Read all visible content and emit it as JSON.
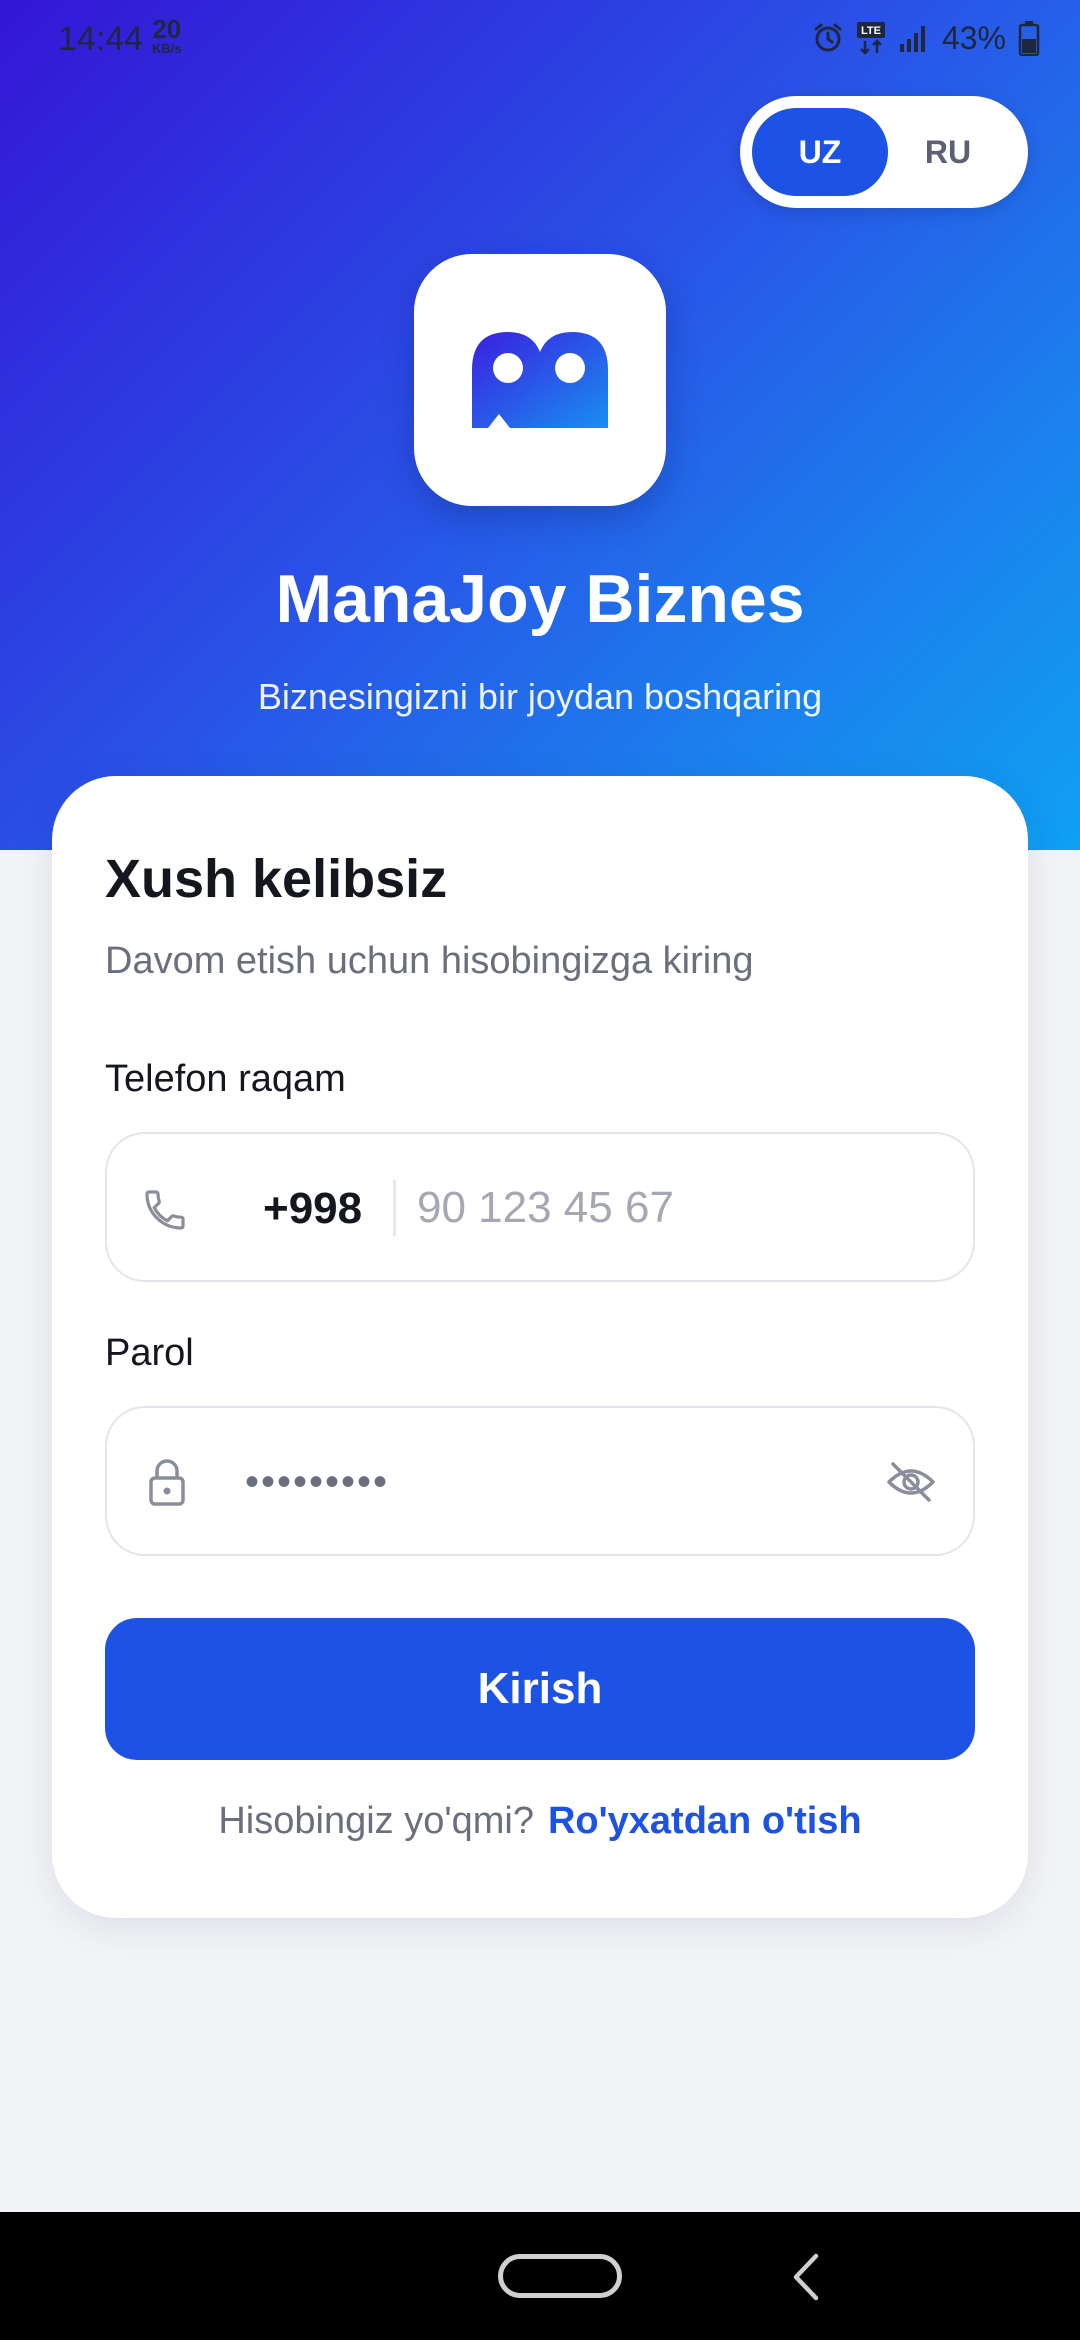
{
  "status_bar": {
    "time": "14:44",
    "net_speed_value": "20",
    "net_speed_unit": "KB/s",
    "network": "LTE",
    "battery": "43%"
  },
  "language_toggle": {
    "options": [
      "UZ",
      "RU"
    ],
    "selected": "UZ"
  },
  "app": {
    "title": "ManaJoy Biznes",
    "subtitle": "Biznesingizni bir joydan boshqaring",
    "logo_icon": "manajoy-logo-icon"
  },
  "login": {
    "heading": "Xush kelibsiz",
    "subheading": "Davom etish uchun hisobingizga kiring",
    "phone_label": "Telefon raqam",
    "dial_code": "+998",
    "phone_placeholder": "90 123 45 67",
    "password_label": "Parol",
    "password_masked": "•••••••••",
    "submit_label": "Kirish",
    "register_question": "Hisobingiz yo'qmi?",
    "register_link": "Ro'yxatdan o'tish"
  },
  "colors": {
    "accent": "#1d53e4",
    "gradient_start": "#3416d6",
    "gradient_end": "#0fa0f2",
    "background": "#f3f4f7"
  }
}
